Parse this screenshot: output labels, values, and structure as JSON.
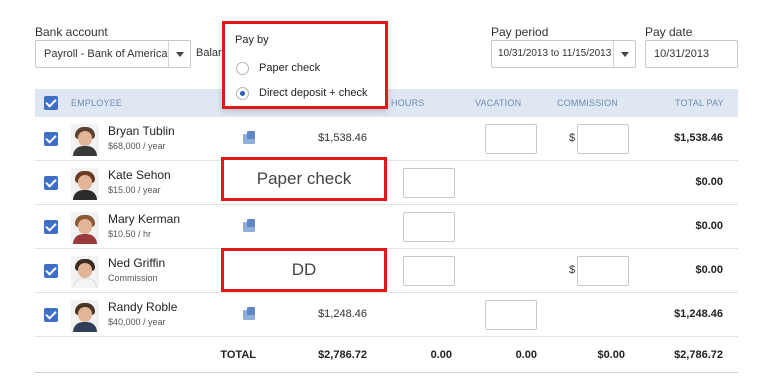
{
  "header": {
    "bank_account_label": "Bank account",
    "bank_account_value": "Payroll - Bank of America",
    "balance_label_partial": "Balar",
    "pay_period_label": "Pay period",
    "pay_period_value": "10/31/2013 to 11/15/2013",
    "pay_date_label": "Pay date",
    "pay_date_value": "10/31/2013"
  },
  "table": {
    "columns": {
      "employee": "EMPLOYEE",
      "hours": "HOURS",
      "vacation": "VACATION",
      "commission": "COMMISSION",
      "total_pay": "TOTAL PAY"
    },
    "rows": [
      {
        "name": "Bryan Tublin",
        "rate": "$68,000 / year",
        "salary": "$1,538.46",
        "dollar": "$",
        "total": "$1,538.46",
        "pay_icon": "direct-deposit-icon"
      },
      {
        "name": "Kate Sehon",
        "rate": "$15.00 / year",
        "salary": "",
        "dollar": "",
        "total": "$0.00",
        "pay_icon": "paper-check-icon"
      },
      {
        "name": "Mary Kerman",
        "rate": "$10.50 / hr",
        "salary": "",
        "dollar": "",
        "total": "$0.00",
        "pay_icon": "direct-deposit-icon"
      },
      {
        "name": "Ned Griffin",
        "rate": "Commission",
        "salary": "",
        "dollar": "$",
        "total": "$0.00",
        "pay_icon": "direct-deposit-icon"
      },
      {
        "name": "Randy Roble",
        "rate": "$40,000 / year",
        "salary": "$1,248.46",
        "dollar": "",
        "total": "$1,248.46",
        "pay_icon": "direct-deposit-icon"
      }
    ],
    "totals": {
      "label": "TOTAL",
      "salary": "$2,786.72",
      "hours": "0.00",
      "vacation": "0.00",
      "commission": "$0.00",
      "total_pay": "$2,786.72"
    }
  },
  "pay_by_popup": {
    "title": "Pay by",
    "options": [
      "Paper check",
      "Direct deposit + check"
    ],
    "selected": "Direct deposit + check"
  },
  "callouts": {
    "paper_check": "Paper check",
    "dd": "DD"
  },
  "colors": {
    "accent": "#3f6fc4",
    "header_bg": "#dfe7f3",
    "highlight": "#e01818"
  }
}
